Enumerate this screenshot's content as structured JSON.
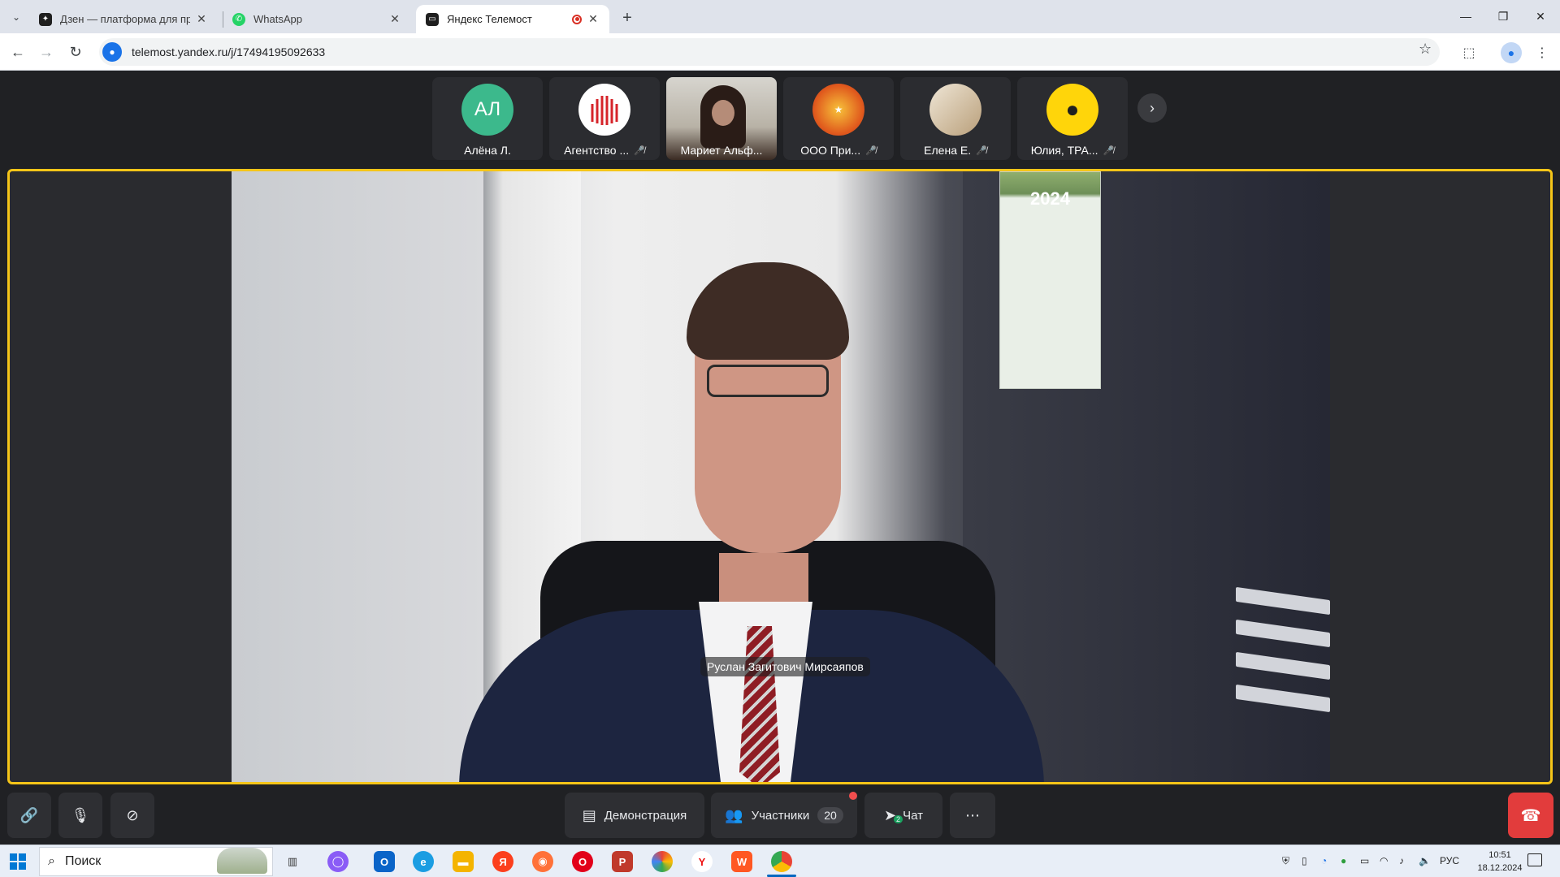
{
  "browser": {
    "tabs": [
      {
        "title": "Дзен — платформа для просмотра",
        "favicon": "dzen-icon"
      },
      {
        "title": "WhatsApp",
        "favicon": "whatsapp-icon"
      },
      {
        "title": "Яндекс Телемост",
        "favicon": "telemost-icon"
      }
    ],
    "url": "telemost.yandex.ru/j/17494195092633"
  },
  "meeting": {
    "participants": [
      {
        "name": "Алёна Л.",
        "initials": "АЛ",
        "avatar_color": "#3cb98c"
      },
      {
        "name": "Агентство ...",
        "avatar_color": "#ffffff"
      },
      {
        "name": "Мариет Альф..."
      },
      {
        "name": "ООО При...",
        "avatar_color": "#e05a1d"
      },
      {
        "name": "Елена Е.",
        "avatar_color": "#d9c9b0"
      },
      {
        "name": "Юлия, ТРА...",
        "avatar_color": "#ffd50a"
      }
    ],
    "active_speaker": "Руслан Загитович Мирсаяпов",
    "calendar_year": "2024",
    "highlight_color": "#f5c518"
  },
  "controls": {
    "demo_label": "Демонстрация",
    "participants_label": "Участники",
    "participants_count": "20",
    "chat_label": "Чат",
    "chat_unread": "2"
  },
  "taskbar": {
    "search_placeholder": "Поиск",
    "lang": "РУС",
    "time": "10:51",
    "date": "18.12.2024"
  }
}
